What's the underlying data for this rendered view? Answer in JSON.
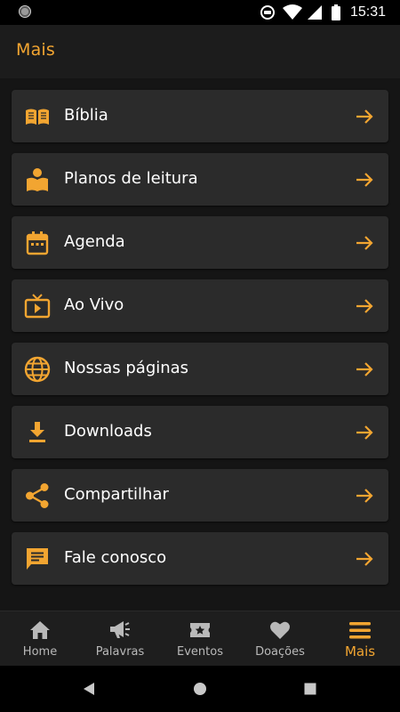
{
  "status_bar": {
    "time": "15:31",
    "icons": [
      "camera-dot-icon",
      "data-saver-icon",
      "wifi-icon",
      "signal-icon",
      "battery-icon"
    ]
  },
  "app_bar": {
    "title": "Mais"
  },
  "colors": {
    "accent": "#f2a531",
    "background": "#151515",
    "card": "#2b2b2b",
    "app_bar": "#1c1c1c",
    "nav_inactive": "#b9b9b9"
  },
  "menu": {
    "items": [
      {
        "label": "Bíblia",
        "icon": "book-icon"
      },
      {
        "label": "Planos de leitura",
        "icon": "reading-plan-icon"
      },
      {
        "label": "Agenda",
        "icon": "calendar-icon"
      },
      {
        "label": "Ao Vivo",
        "icon": "live-tv-icon"
      },
      {
        "label": "Nossas páginas",
        "icon": "globe-icon"
      },
      {
        "label": "Downloads",
        "icon": "download-icon"
      },
      {
        "label": "Compartilhar",
        "icon": "share-icon"
      },
      {
        "label": "Fale conosco",
        "icon": "chat-icon"
      }
    ]
  },
  "bottom_nav": {
    "items": [
      {
        "label": "Home",
        "icon": "home-icon"
      },
      {
        "label": "Palavras",
        "icon": "megaphone-icon"
      },
      {
        "label": "Eventos",
        "icon": "ticket-icon"
      },
      {
        "label": "Doações",
        "icon": "heart-icon"
      },
      {
        "label": "Mais",
        "icon": "menu-icon",
        "active": true
      }
    ]
  },
  "system_nav": {
    "buttons": [
      "back-icon",
      "home-circle-icon",
      "recents-icon"
    ]
  }
}
